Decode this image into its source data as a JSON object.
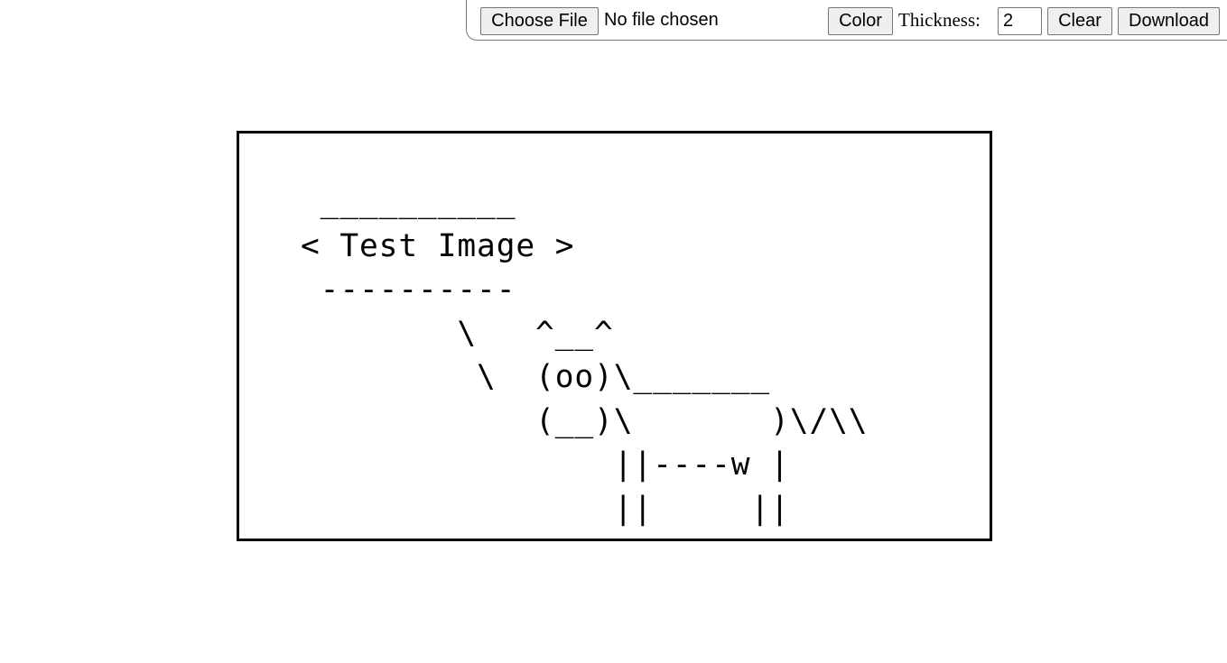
{
  "toolbar": {
    "choose_file_label": "Choose File",
    "file_status": "No file chosen",
    "color_label": "Color",
    "thickness_label": "Thickness:",
    "thickness_value": "2",
    "clear_label": "Clear",
    "download_label": "Download"
  },
  "canvas": {
    "ascii_art": " __________\n< Test Image >\n ----------\n        \\   ^__^\n         \\  (oo)\\_______\n            (__)\\       )\\/\\\\\n                ||----w |\n                ||     ||"
  }
}
